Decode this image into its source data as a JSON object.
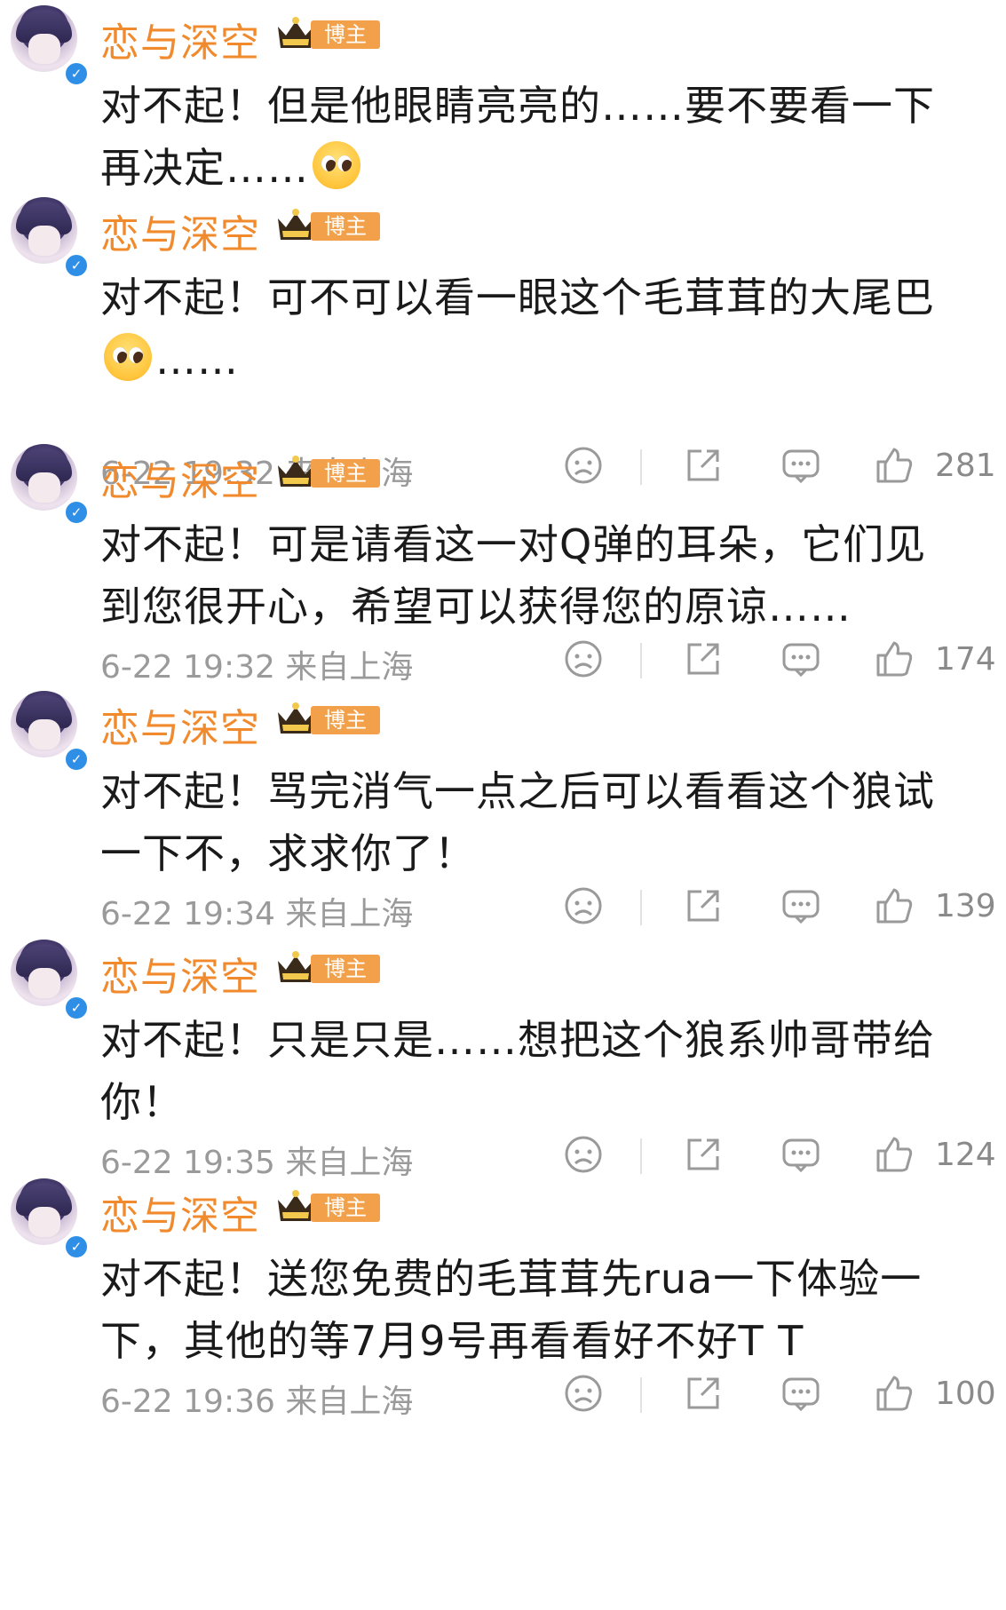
{
  "posts": [
    {
      "author": "恋与深空",
      "badge": "博主",
      "lines": [
        "对不起！但是他眼睛亮亮的……要不要看一下",
        "再决定……"
      ],
      "emoji": "pleading-face"
    },
    {
      "author": "恋与深空",
      "badge": "博主",
      "lines": [
        "对不起！可不可以看一眼这个毛茸茸的大尾巴",
        "……"
      ],
      "emoji": "pleading-face",
      "time": "6-22 19:32 来自上海",
      "likes": "281"
    },
    {
      "author": "恋与深空",
      "badge": "博主",
      "lines": [
        "对不起！可是请看这一对Q弹的耳朵，它们见",
        "到您很开心，希望可以获得您的原谅……"
      ],
      "time": "6-22 19:32 来自上海",
      "likes": "174"
    },
    {
      "author": "恋与深空",
      "badge": "博主",
      "lines": [
        "对不起！骂完消气一点之后可以看看这个狼试",
        "一下不，求求你了！"
      ],
      "time": "6-22 19:34 来自上海",
      "likes": "139"
    },
    {
      "author": "恋与深空",
      "badge": "博主",
      "lines": [
        "对不起！只是只是……想把这个狼系帅哥带给",
        "你！"
      ],
      "time": "6-22 19:35 来自上海",
      "likes": "124"
    },
    {
      "author": "恋与深空",
      "badge": "博主",
      "lines": [
        "对不起！送您免费的毛茸茸先rua一下体验一",
        "下，其他的等7月9号再看看好不好T T"
      ],
      "time": "6-22 19:36 来自上海",
      "likes": "100"
    }
  ],
  "icons": [
    "verified-icon",
    "crown-badge-icon",
    "dislike-face-icon",
    "share-icon",
    "comment-icon",
    "like-icon"
  ],
  "colors": {
    "author": "#f08a2c",
    "badge": "#f2a14a",
    "verified": "#2f8ee6",
    "meta": "#9a9a9a"
  }
}
